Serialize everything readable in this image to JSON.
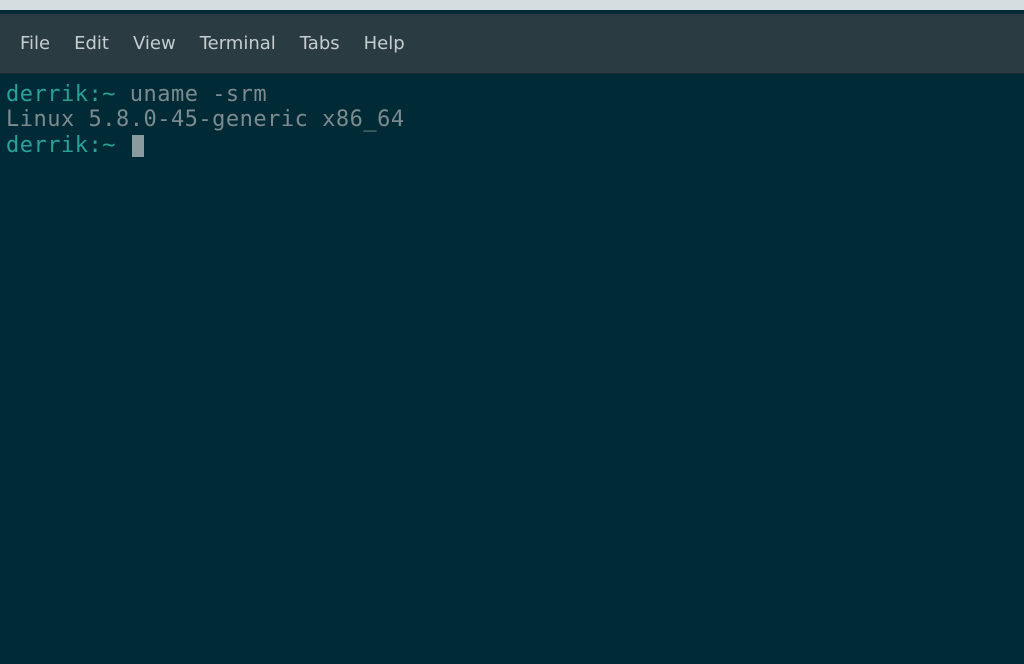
{
  "menubar": {
    "items": [
      {
        "label": "File"
      },
      {
        "label": "Edit"
      },
      {
        "label": "View"
      },
      {
        "label": "Terminal"
      },
      {
        "label": "Tabs"
      },
      {
        "label": "Help"
      }
    ]
  },
  "terminal": {
    "lines": [
      {
        "prompt": "derrik:~ ",
        "command": "uname -srm"
      },
      {
        "output": "Linux 5.8.0-45-generic x86_64"
      },
      {
        "prompt": "derrik:~ ",
        "command": "",
        "cursor": true
      }
    ]
  }
}
